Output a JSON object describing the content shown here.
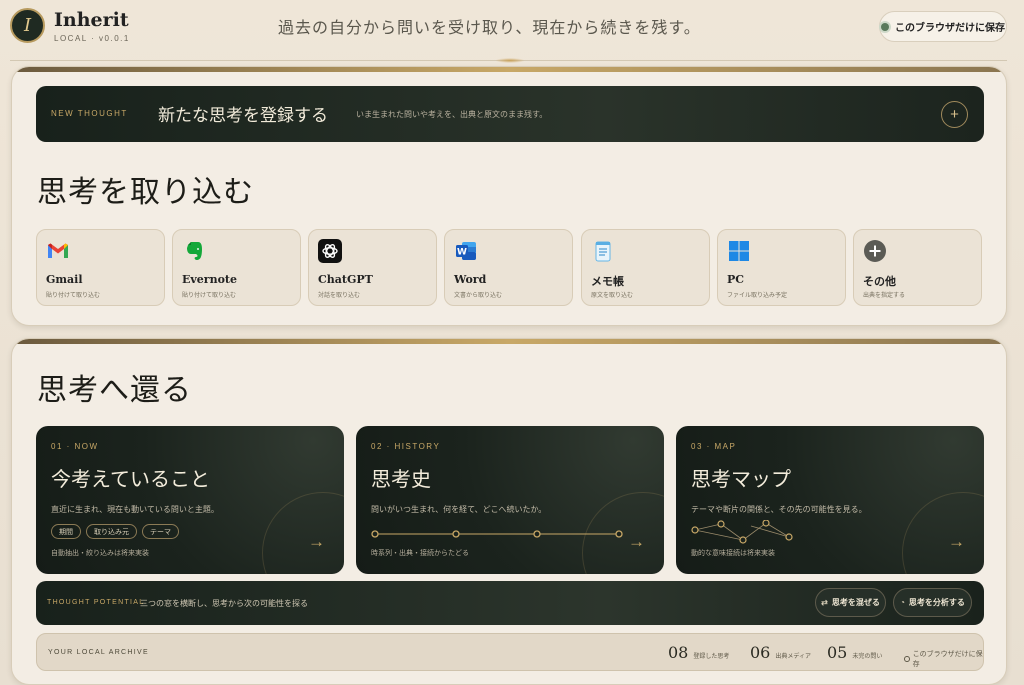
{
  "brand": {
    "logo_letter": "I",
    "name": "Inherit",
    "version": "LOCAL · v0.0.1"
  },
  "header": {
    "tagline": "過去の自分から問いを受け取り、現在から続きを残す。",
    "save_local": "このブラウザだけに保存"
  },
  "new_thought": {
    "kicker": "NEW THOUGHT",
    "title": "新たな思考を登録する",
    "subtitle": "いま生まれた問いや考えを、出典と原文のまま残す。",
    "plus": "+"
  },
  "import_section": {
    "title": "思考を取り込む",
    "sources": [
      {
        "icon": "gmail-icon",
        "name": "Gmail",
        "desc": "貼り付けて取り込む"
      },
      {
        "icon": "evernote-icon",
        "name": "Evernote",
        "desc": "貼り付けて取り込む"
      },
      {
        "icon": "chatgpt-icon",
        "name": "ChatGPT",
        "desc": "対話を取り込む"
      },
      {
        "icon": "word-icon",
        "name": "Word",
        "desc": "文書から取り込む"
      },
      {
        "icon": "memo-icon",
        "name": "メモ帳",
        "desc": "原文を取り込む"
      },
      {
        "icon": "windows-icon",
        "name": "PC",
        "desc": "ファイル取り込み予定"
      },
      {
        "icon": "plus-circle-icon",
        "name": "その他",
        "desc": "出典を指定する"
      }
    ]
  },
  "return_section": {
    "title": "思考へ還る",
    "cards": [
      {
        "kicker": "01 · NOW",
        "title": "今考えていること",
        "desc": "直近に生まれ、現在も動いている問いと主題。",
        "chips": [
          "期間",
          "取り込み元",
          "テーマ"
        ],
        "note": "自動抽出・絞り込みは将来実装",
        "arrow": "→"
      },
      {
        "kicker": "02 · HISTORY",
        "title": "思考史",
        "desc": "問いがいつ生まれ、何を経て、どこへ続いたか。",
        "note": "時系列・出典・接続からたどる",
        "arrow": "→"
      },
      {
        "kicker": "03 · MAP",
        "title": "思考マップ",
        "desc": "テーマや断片の関係と、その先の可能性を見る。",
        "note": "動的な意味接続は将来実装",
        "arrow": "→"
      }
    ],
    "potential": {
      "kicker": "THOUGHT POTENTIAL",
      "subtitle": "三つの窓を横断し、思考から次の可能性を探る",
      "mix_button": "思考を混ぜる",
      "analyze_button": "思考を分析する",
      "mix_glyph": "⇄",
      "analyze_glyph": "◔"
    },
    "archive": {
      "kicker": "YOUR LOCAL ARCHIVE",
      "stats": [
        {
          "num": "08",
          "label": "登録した思考"
        },
        {
          "num": "06",
          "label": "出典メディア"
        },
        {
          "num": "05",
          "label": "未完の問い"
        }
      ],
      "local_note": "このブラウザだけに保存"
    }
  },
  "colors": {
    "accent_gold": "#c8a867",
    "dark_green": "#1b231d",
    "panel_bg": "#f3ede4"
  }
}
